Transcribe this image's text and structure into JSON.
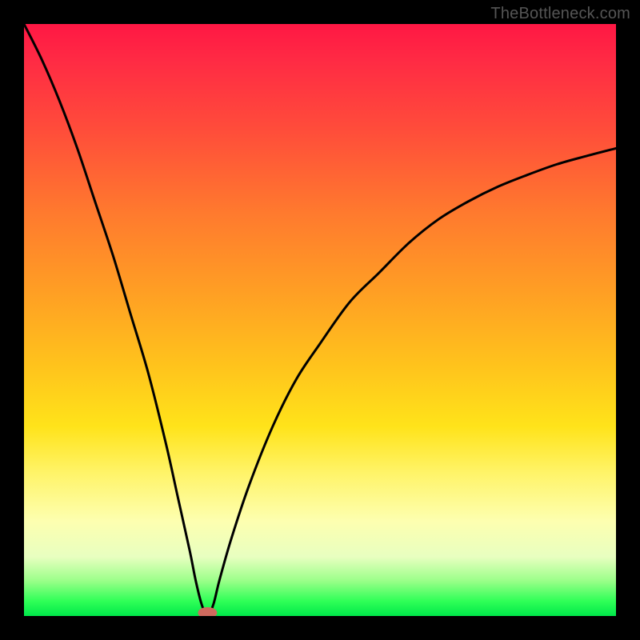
{
  "watermark": "TheBottleneck.com",
  "colors": {
    "frame_bg": "#000000",
    "curve_stroke": "#000000",
    "marker_fill": "#cf6a5e",
    "gradient_top": "#ff1744",
    "gradient_bottom": "#00e84a"
  },
  "chart_data": {
    "type": "line",
    "title": "",
    "xlabel": "",
    "ylabel": "",
    "xlim": [
      0,
      100
    ],
    "ylim": [
      0,
      100
    ],
    "grid": false,
    "legend": false,
    "optimum_x": 31,
    "series": [
      {
        "name": "bottleneck-curve",
        "x": [
          0,
          3,
          6,
          9,
          12,
          15,
          18,
          21,
          24,
          26,
          28,
          29,
          30,
          31,
          32,
          33,
          35,
          38,
          42,
          46,
          50,
          55,
          60,
          65,
          70,
          75,
          80,
          85,
          90,
          95,
          100
        ],
        "y": [
          100,
          94,
          87,
          79,
          70,
          61,
          51,
          41,
          29,
          20,
          11,
          6,
          2,
          0,
          2,
          6,
          13,
          22,
          32,
          40,
          46,
          53,
          58,
          63,
          67,
          70,
          72.5,
          74.5,
          76.3,
          77.7,
          79
        ]
      }
    ],
    "markers": [
      {
        "name": "optimum-marker",
        "x": 31,
        "y": 0
      }
    ]
  }
}
